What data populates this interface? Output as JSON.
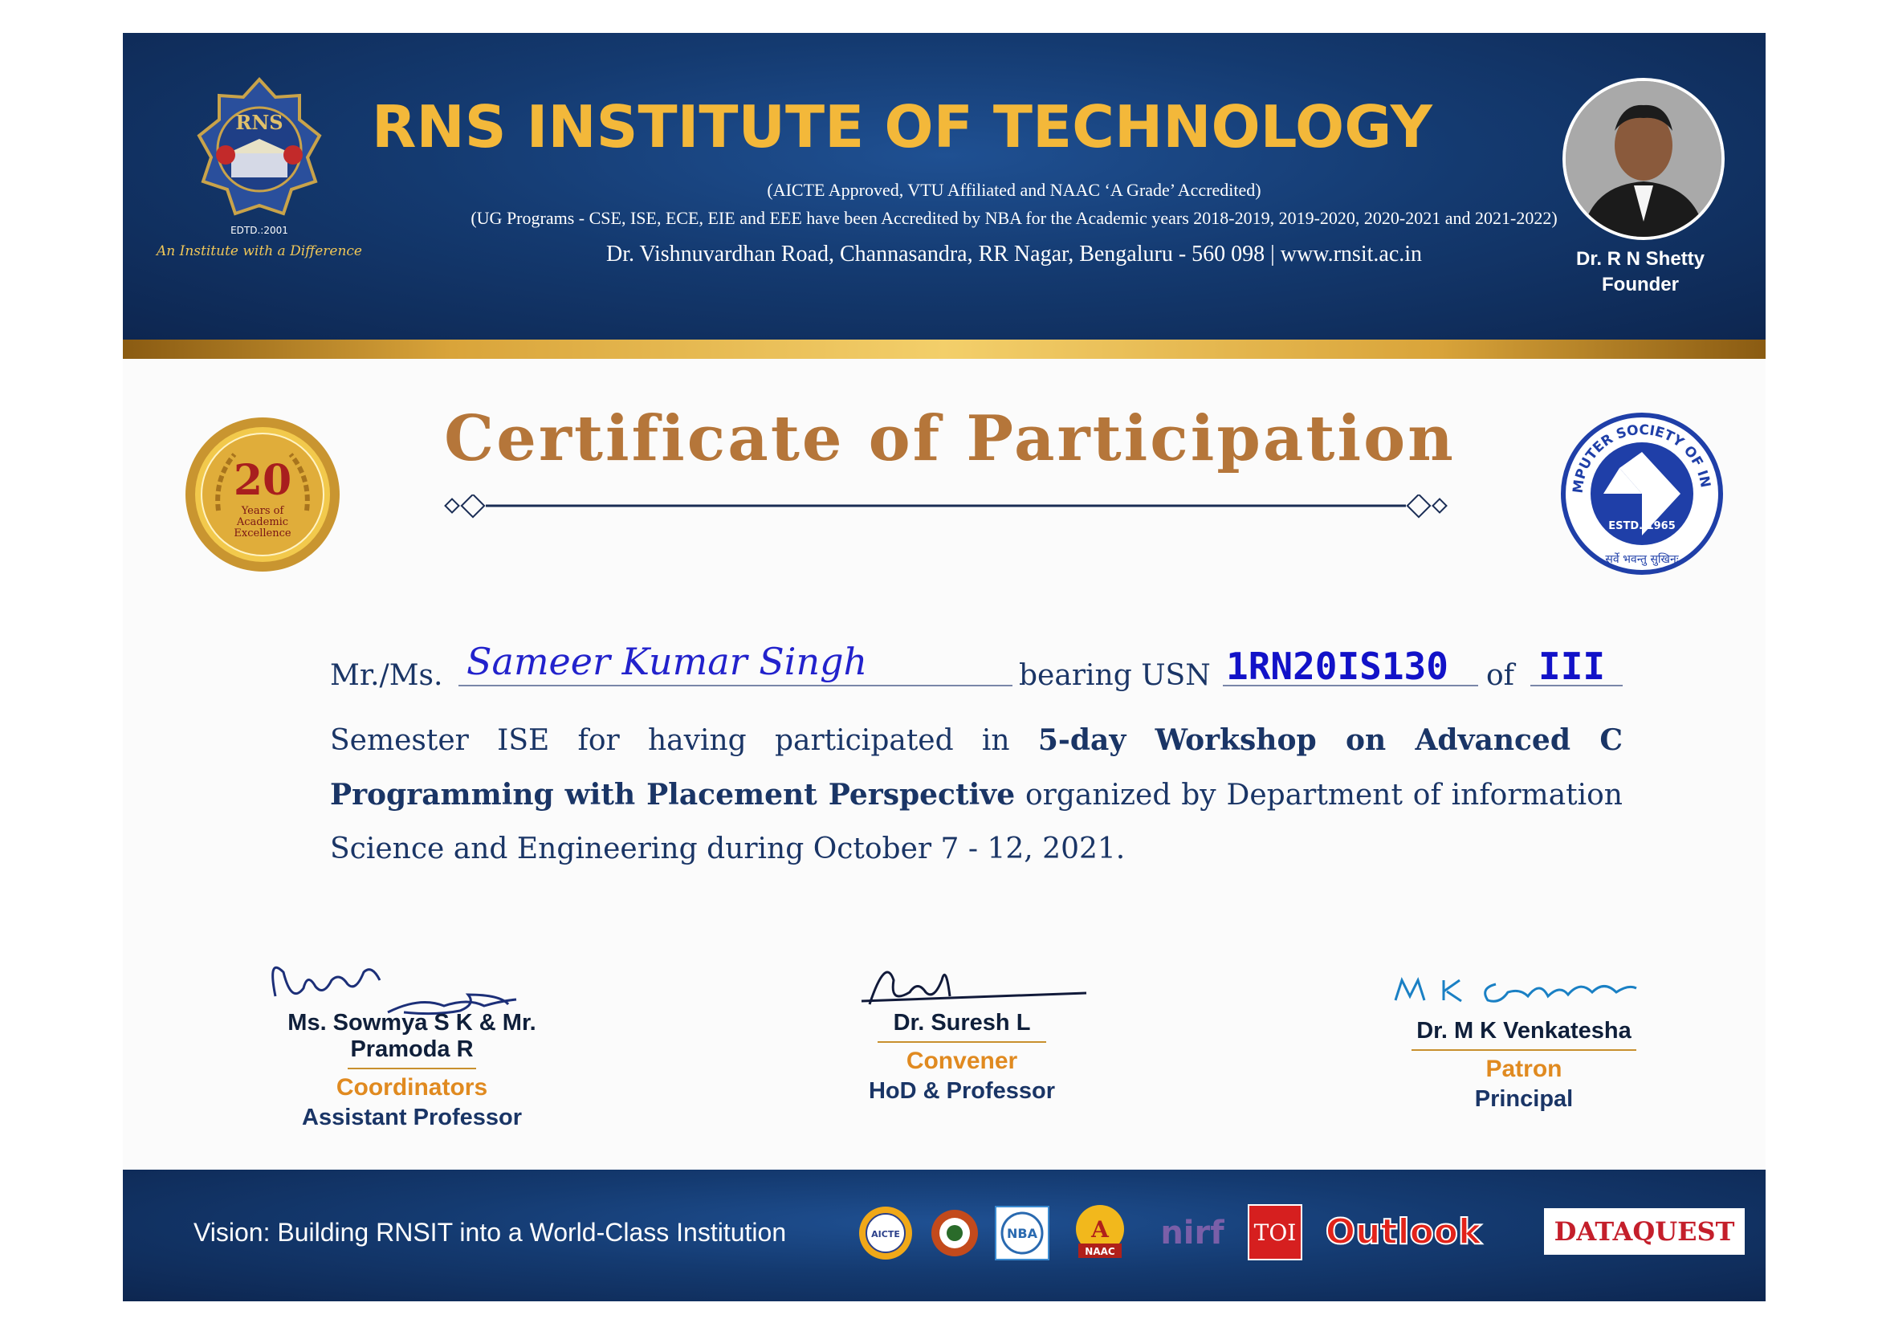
{
  "header": {
    "logo_text": "RNS",
    "logo_subtext": "INSTITUTE OF TECHNOLOGY",
    "logo_estd": "EDTD.:2001",
    "tagline": "An Institute with a Difference",
    "institute_name": "RNS INSTITUTE OF TECHNOLOGY",
    "accreditation_line1": "(AICTE Approved, VTU Affiliated and NAAC ‘A Grade’ Accredited)",
    "accreditation_line2": "(UG Programs - CSE, ISE, ECE, EIE and EEE have been Accredited by NBA for the Academic years 2018-2019, 2019-2020, 2020-2021 and 2021-2022)",
    "address": "Dr. Vishnuvardhan Road, Channasandra, RR Nagar, Bengaluru - 560 098 | www.rnsit.ac.in",
    "founder_name": "Dr. R N Shetty",
    "founder_role": "Founder"
  },
  "badges": {
    "years_number": "20",
    "years_text": "Years of Academic Excellence",
    "csi_name": "COMPUTER SOCIETY OF INDIA",
    "csi_estd": "ESTD. 1965",
    "csi_motto": "सर्वे भवन्तु सुखिनः"
  },
  "title": "Certificate of Participation",
  "body": {
    "prefix": "Mr./Ms.",
    "participant_name": "Sameer Kumar Singh",
    "usn_label": "bearing USN",
    "usn": "1RN20IS130",
    "of_label": "of",
    "semester": "III",
    "line2_a": "Semester ISE  for having  participated  in ",
    "line2_bold": "5-day  Workshop on  Advanced C",
    "line3_bold": "Programming with Placement Perspective",
    "line3_b": " organized by Department of information",
    "line4": "Science and Engineering during October 7 - 12, 2021."
  },
  "signatures": [
    {
      "name": "Ms. Sowmya S K & Mr. Pramoda R",
      "role": "Coordinators",
      "title": "Assistant Professor"
    },
    {
      "name": "Dr. Suresh L",
      "role": "Convener",
      "title": "HoD & Professor"
    },
    {
      "name": "Dr. M K Venkatesha",
      "role": "Patron",
      "title": "Principal"
    }
  ],
  "footer": {
    "vision": "Vision: Building RNSIT into a World-Class Institution",
    "logos": [
      "AICTE",
      "VTU",
      "NBA",
      "A NAAC",
      "nirf",
      "TOI",
      "Outlook",
      "DATAQUEST"
    ]
  },
  "colors": {
    "navy": "#143a70",
    "gold": "#f3b83a",
    "title_brown": "#b5763a",
    "ink_blue": "#1212c8",
    "orange": "#e08a20"
  }
}
